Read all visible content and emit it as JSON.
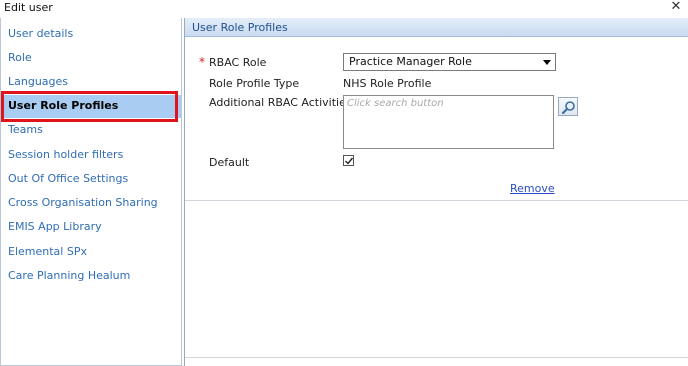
{
  "window": {
    "title": "Edit user",
    "close_glyph": "✕"
  },
  "sidebar": {
    "items": [
      {
        "label": "User details"
      },
      {
        "label": "Role"
      },
      {
        "label": "Languages"
      },
      {
        "label": "User Role Profiles"
      },
      {
        "label": "Teams"
      },
      {
        "label": "Session holder filters"
      },
      {
        "label": "Out Of Office Settings"
      },
      {
        "label": "Cross Organisation Sharing"
      },
      {
        "label": "EMIS App Library"
      },
      {
        "label": "Elemental SPx"
      },
      {
        "label": "Care Planning Healum"
      }
    ],
    "active_item": "User Role Profiles"
  },
  "main": {
    "section_title": "User Role Profiles",
    "fields": {
      "rbac_role_label": "RBAC Role",
      "rbac_role_value": "Practice Manager Role",
      "role_profile_type_label": "Role Profile Type",
      "role_profile_type_value": "NHS Role Profile",
      "additional_activities_label": "Additional RBAC Activities",
      "additional_activities_placeholder": "Click search button",
      "default_label": "Default",
      "default_checked": true
    },
    "remove_link": "Remove",
    "required_marker": "*"
  },
  "colors": {
    "active_bg": "#a9cdf2",
    "link": "#2f6db5",
    "highlight": "#e0141c",
    "header_text": "#1f4f8f"
  },
  "icons": {
    "search": "magnifier-icon",
    "close": "close-icon",
    "dropdown": "chevron-down-icon",
    "check": "checkmark-icon"
  }
}
